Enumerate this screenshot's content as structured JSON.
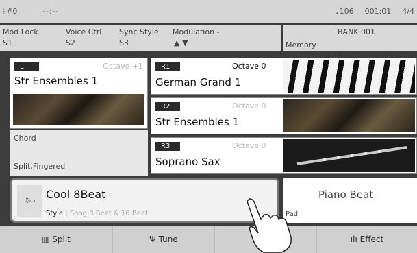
{
  "status": {
    "key": "♭#0",
    "time_placeholder": "--:--",
    "tempo": "♩106",
    "position": "001:01",
    "meter": "4/4"
  },
  "controls": [
    {
      "label": "Mod Lock",
      "value": "S1"
    },
    {
      "label": "Voice Ctrl",
      "value": "S2"
    },
    {
      "label": "Sync Style",
      "value": "S3"
    },
    {
      "label": "Modulation -",
      "value": "▲        ▼"
    }
  ],
  "bank": {
    "title": "BANK 001",
    "memory": "Memory"
  },
  "left_voice": {
    "badge": "L",
    "octave": "Octave +1",
    "name": "Str Ensembles 1",
    "image": "strings-photo"
  },
  "right_voices": [
    {
      "badge": "R1",
      "octave": "Octave 0",
      "name": "German Grand 1",
      "image": "piano-photo"
    },
    {
      "badge": "R2",
      "octave": "Octave 0",
      "name": "Str Ensembles 1",
      "image": "strings-photo"
    },
    {
      "badge": "R3",
      "octave": "Octave 0",
      "name": "Soprano Sax",
      "image": "sax-photo"
    }
  ],
  "chord": {
    "title": "Chord",
    "mode": "Split,Fingered"
  },
  "style": {
    "name": "Cool 8Beat",
    "label": "Style",
    "category": "Song 8 Beat & 16 Beat",
    "icon": "style-icon"
  },
  "pad": {
    "name": "Piano Beat",
    "label": "Pad"
  },
  "bottom_buttons": [
    {
      "label": "Split",
      "icon": "keyboard-icon"
    },
    {
      "label": "Tune",
      "icon": "tuning-fork-icon"
    },
    {
      "label": "",
      "icon": "metronome-icon"
    },
    {
      "label": "Effect",
      "icon": "effect-bars-icon"
    }
  ]
}
